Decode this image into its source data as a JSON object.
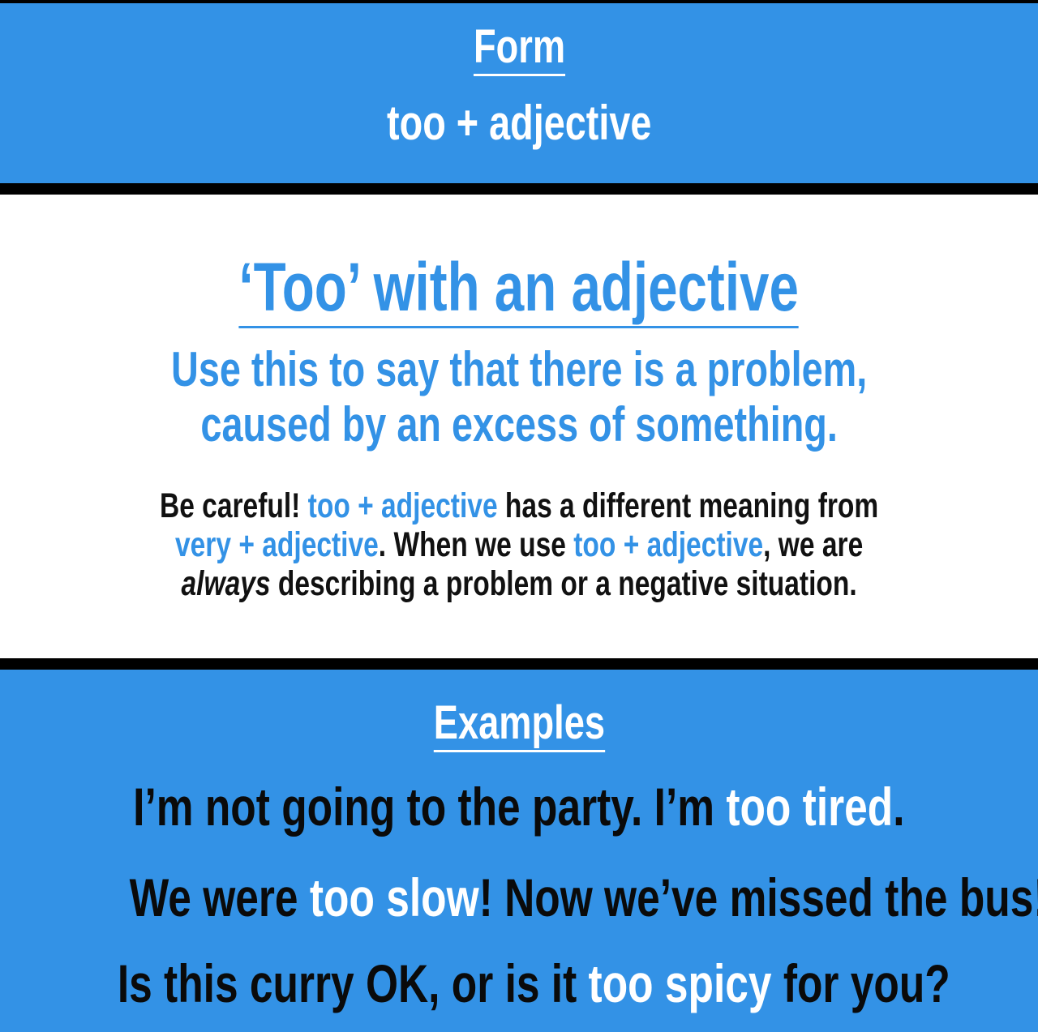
{
  "form": {
    "heading": "Form",
    "formula": "too + adjective"
  },
  "explanation": {
    "title": "‘Too’ with an adjective",
    "description_line1": "Use this to say that there is a problem,",
    "description_line2": "caused by an excess of something.",
    "note": {
      "line1_prefix": "Be careful! ",
      "line1_highlight": "too + adjective",
      "line1_suffix": " has a different meaning from",
      "line2_highlight1": "very + adjective",
      "line2_middle": ". When we use ",
      "line2_highlight2": "too + adjective",
      "line2_suffix": ", we are",
      "line3_emphasis": "always",
      "line3_suffix": " describing a problem or a negative situation."
    }
  },
  "examples": {
    "heading": "Examples",
    "items": [
      {
        "before": "I’m not going to the party. I’m ",
        "highlight": "too tired",
        "after": "."
      },
      {
        "before": "We were ",
        "highlight": "too slow",
        "after": "! Now we’ve missed the bus!"
      },
      {
        "before": "Is this curry OK, or is it ",
        "highlight": "too spicy",
        "after": " for you?"
      }
    ]
  },
  "colors": {
    "accent_blue": "#3392e6",
    "divider": "#000000",
    "text_dark": "#111111",
    "text_light": "#ffffff"
  }
}
